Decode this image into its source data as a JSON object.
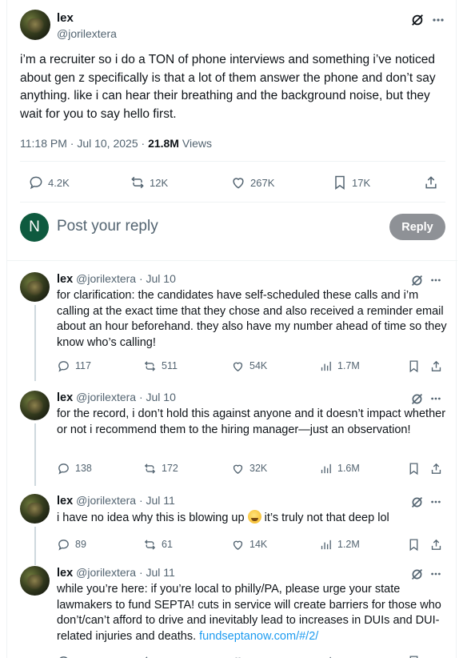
{
  "main_post": {
    "name": "lex",
    "handle": "@jorilextera",
    "text": "i’m a recruiter so i do a TON of phone interviews and something i’ve noticed about gen z specifically is that a lot of them answer the phone and don’t say anything. like i can hear their breathing and the background noise, but they wait for you to say hello first.",
    "time": "11:18 PM · Jul 10, 2025 · ",
    "views_count": "21.8M",
    "views_label": " Views",
    "stats": {
      "replies": "4.2K",
      "reposts": "12K",
      "likes": "267K",
      "bookmarks": "17K"
    }
  },
  "reply_box": {
    "avatar_letter": "N",
    "placeholder": "Post your reply",
    "button": "Reply"
  },
  "thread": [
    {
      "name": "lex",
      "handle": "@jorilextera",
      "date": " · Jul 10",
      "text": "for clarification: the candidates have self-scheduled these calls and i’m calling at the exact time that they chose and also received a reminder email about an hour beforehand. they also have my number ahead of time so they know who’s calling!",
      "replies": "117",
      "reposts": "511",
      "likes": "54K",
      "views": "1.7M"
    },
    {
      "name": "lex",
      "handle": "@jorilextera",
      "date": " · Jul 10",
      "text": "for the record, i don’t hold this against anyone and it doesn’t impact whether or not i recommend them to the hiring manager—just an observation!",
      "replies": "138",
      "reposts": "172",
      "likes": "32K",
      "views": "1.6M"
    },
    {
      "name": "lex",
      "handle": "@jorilextera",
      "date": " · Jul 11",
      "text_before": "i have no idea why this is blowing up ",
      "text_after": " it’s truly not that deep lol",
      "emoji": "sweat-smile-emoji",
      "replies": "89",
      "reposts": "61",
      "likes": "14K",
      "views": "1.2M"
    },
    {
      "name": "lex",
      "handle": "@jorilextera",
      "date": " · Jul 11",
      "text": "while you’re here: if you’re local to philly/PA, please urge your state lawmakers to fund SEPTA! cuts in service will create barriers for those who don’t/can’t afford to drive and inevitably lead to increases in DUIs and DUI-related injuries and deaths. ",
      "link": "fundseptanow.com/#/2/"
    }
  ],
  "colors": {
    "text": "#0f1419",
    "muted": "#536471",
    "link": "#1d9bf0",
    "reply_button": "#8e9196",
    "reply_avatar": "#0e5a3f"
  }
}
